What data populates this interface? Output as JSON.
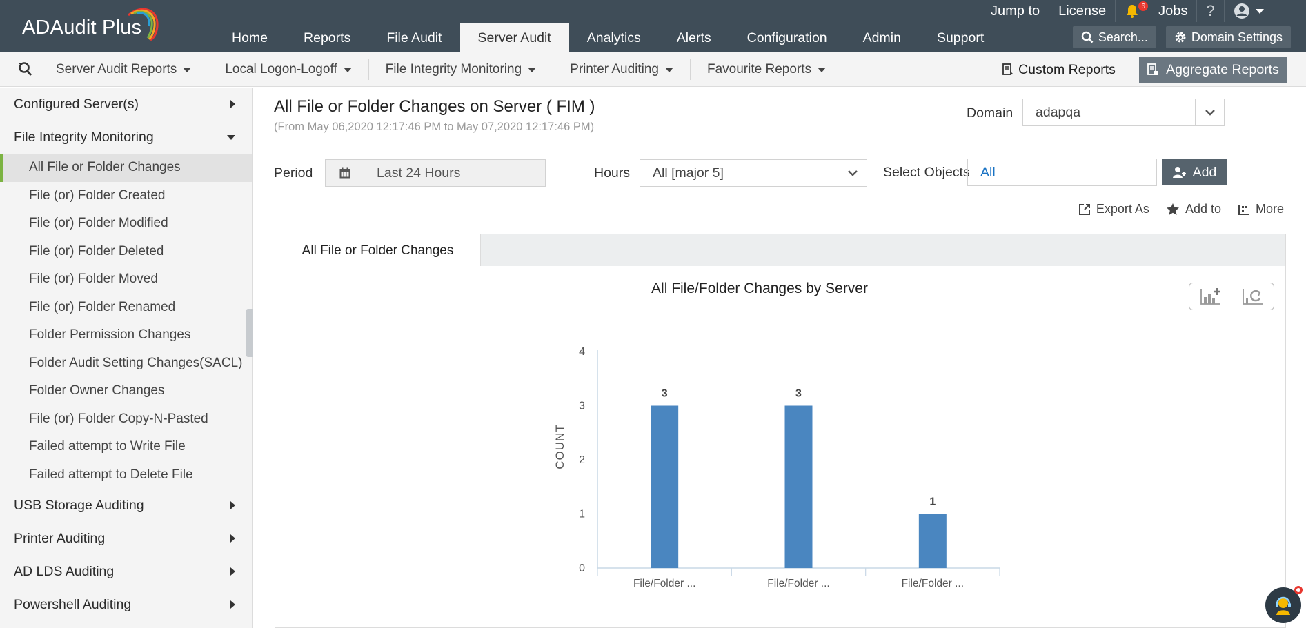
{
  "app": {
    "logo_text": "ADAudit Plus"
  },
  "topbar": {
    "jump_to": "Jump to",
    "license": "License",
    "notification_count": "6",
    "jobs": "Jobs",
    "help": "?",
    "nav": [
      "Home",
      "Reports",
      "File Audit",
      "Server Audit",
      "Analytics",
      "Alerts",
      "Configuration",
      "Admin",
      "Support"
    ],
    "active_nav": "Server Audit",
    "search_label": "Search...",
    "domain_settings_label": "Domain Settings"
  },
  "subbar": {
    "items": [
      "Server Audit Reports",
      "Local Logon-Logoff",
      "File Integrity Monitoring",
      "Printer Auditing",
      "Favourite Reports"
    ],
    "custom_reports": "Custom Reports",
    "aggregate_reports": "Aggregate Reports"
  },
  "sidebar": {
    "groups": [
      {
        "label": "Configured Server(s)",
        "expanded": false
      },
      {
        "label": "File Integrity Monitoring",
        "expanded": true
      }
    ],
    "fim_items": [
      "All File or Folder Changes",
      "File (or) Folder Created",
      "File (or) Folder Modified",
      "File (or) Folder Deleted",
      "File (or) Folder Moved",
      "File (or) Folder Renamed",
      "Folder Permission Changes",
      "Folder Audit Setting Changes(SACL)",
      "Folder Owner Changes",
      "File (or) Folder Copy-N-Pasted",
      "Failed attempt to Write File",
      "Failed attempt to Delete File"
    ],
    "active_item": "All File or Folder Changes",
    "bottom_groups": [
      "USB Storage Auditing",
      "Printer Auditing",
      "AD LDS Auditing",
      "Powershell Auditing"
    ]
  },
  "report": {
    "title": "All File or Folder Changes on Server ( FIM )",
    "subtitle": "(From May 06,2020 12:17:46 PM to May 07,2020 12:17:46 PM)",
    "domain_label": "Domain",
    "domain_value": "adapqa",
    "period_label": "Period",
    "period_value": "Last 24 Hours",
    "hours_label": "Hours",
    "hours_value": "All [major 5]",
    "objects_label": "Select Objects",
    "objects_value": "All",
    "add_label": "Add",
    "actions": {
      "export": "Export As",
      "add_to": "Add to",
      "more": "More"
    },
    "tab_label": "All File or Folder Changes"
  },
  "chart_data": {
    "type": "bar",
    "title": "All File/Folder Changes by Server",
    "xlabel": "",
    "ylabel": "COUNT",
    "categories": [
      "File/Folder ...",
      "File/Folder ...",
      "File/Folder ..."
    ],
    "values": [
      3,
      3,
      1
    ],
    "ylim": [
      0,
      4
    ],
    "yticks": [
      0,
      1,
      2,
      3,
      4
    ],
    "bar_color": "#4a86c0",
    "grid": false,
    "data_labels": true
  },
  "colors": {
    "topbar": "#3f4d58",
    "accent_green": "#7cb342",
    "link_blue": "#1a73c4",
    "badge_red": "#e8372f"
  }
}
